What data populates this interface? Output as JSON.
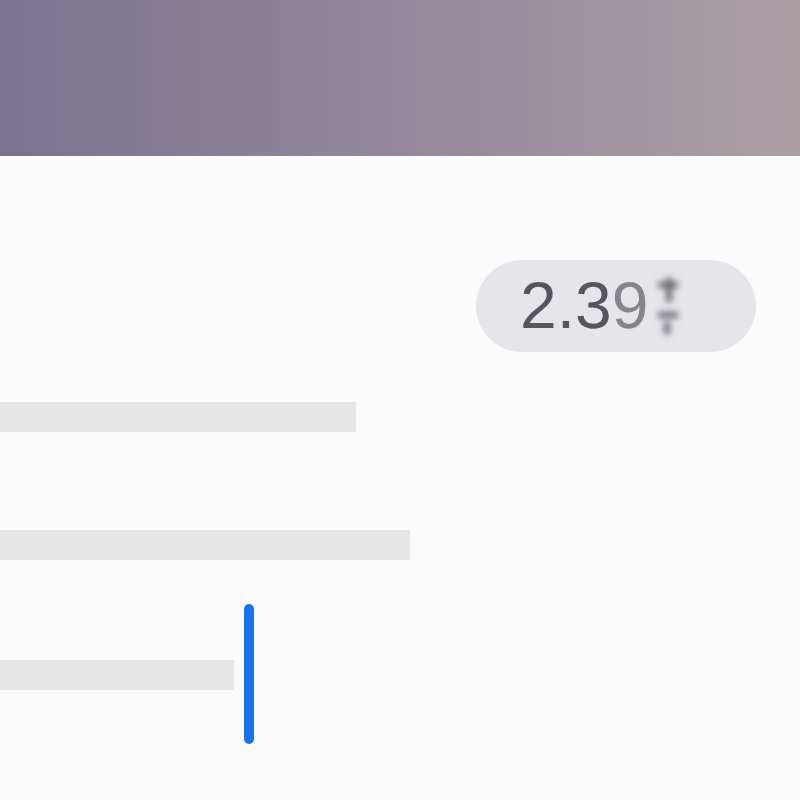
{
  "badge": {
    "value": "2.3",
    "rolling_digit": "9"
  }
}
